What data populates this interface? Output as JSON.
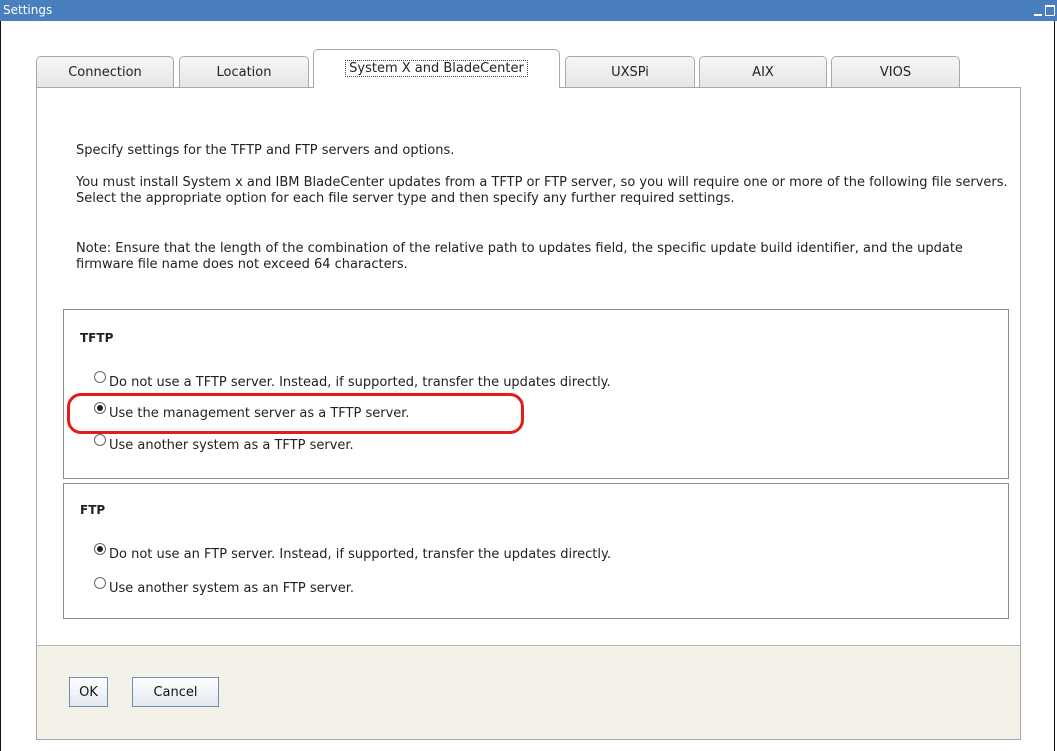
{
  "window": {
    "title": "Settings"
  },
  "tabs": [
    {
      "label": "Connection"
    },
    {
      "label": "Location"
    },
    {
      "label": "System X and BladeCenter"
    },
    {
      "label": "UXSPi"
    },
    {
      "label": "AIX"
    },
    {
      "label": "VIOS"
    }
  ],
  "active_tab": "System X and BladeCenter",
  "intro": {
    "p1": "Specify settings for the TFTP and FTP servers and options.",
    "p2": "You must install System x and IBM BladeCenter updates from a TFTP or FTP server, so you will require one or more of the following file servers. Select the appropriate option for each file server type and then specify any further required settings.",
    "p3": "Note: Ensure that the length of the combination of the relative path to updates field, the specific update build identifier, and the update firmware file name does not exceed 64 characters."
  },
  "tftp": {
    "title": "TFTP",
    "options": [
      {
        "label": "Do not use a TFTP server. Instead, if supported, transfer the updates directly.",
        "checked": false
      },
      {
        "label": "Use the management server as a TFTP server.",
        "checked": true
      },
      {
        "label": "Use another system as a TFTP server.",
        "checked": false
      }
    ]
  },
  "ftp": {
    "title": "FTP",
    "options": [
      {
        "label": "Do not use an FTP server. Instead, if supported, transfer the updates directly.",
        "checked": true
      },
      {
        "label": "Use another system as an FTP server.",
        "checked": false
      }
    ]
  },
  "buttons": {
    "ok": "OK",
    "cancel": "Cancel"
  },
  "colors": {
    "titlebar": "#4a7fbf",
    "highlight": "#e41b1b",
    "footer": "#f3f1e8"
  }
}
